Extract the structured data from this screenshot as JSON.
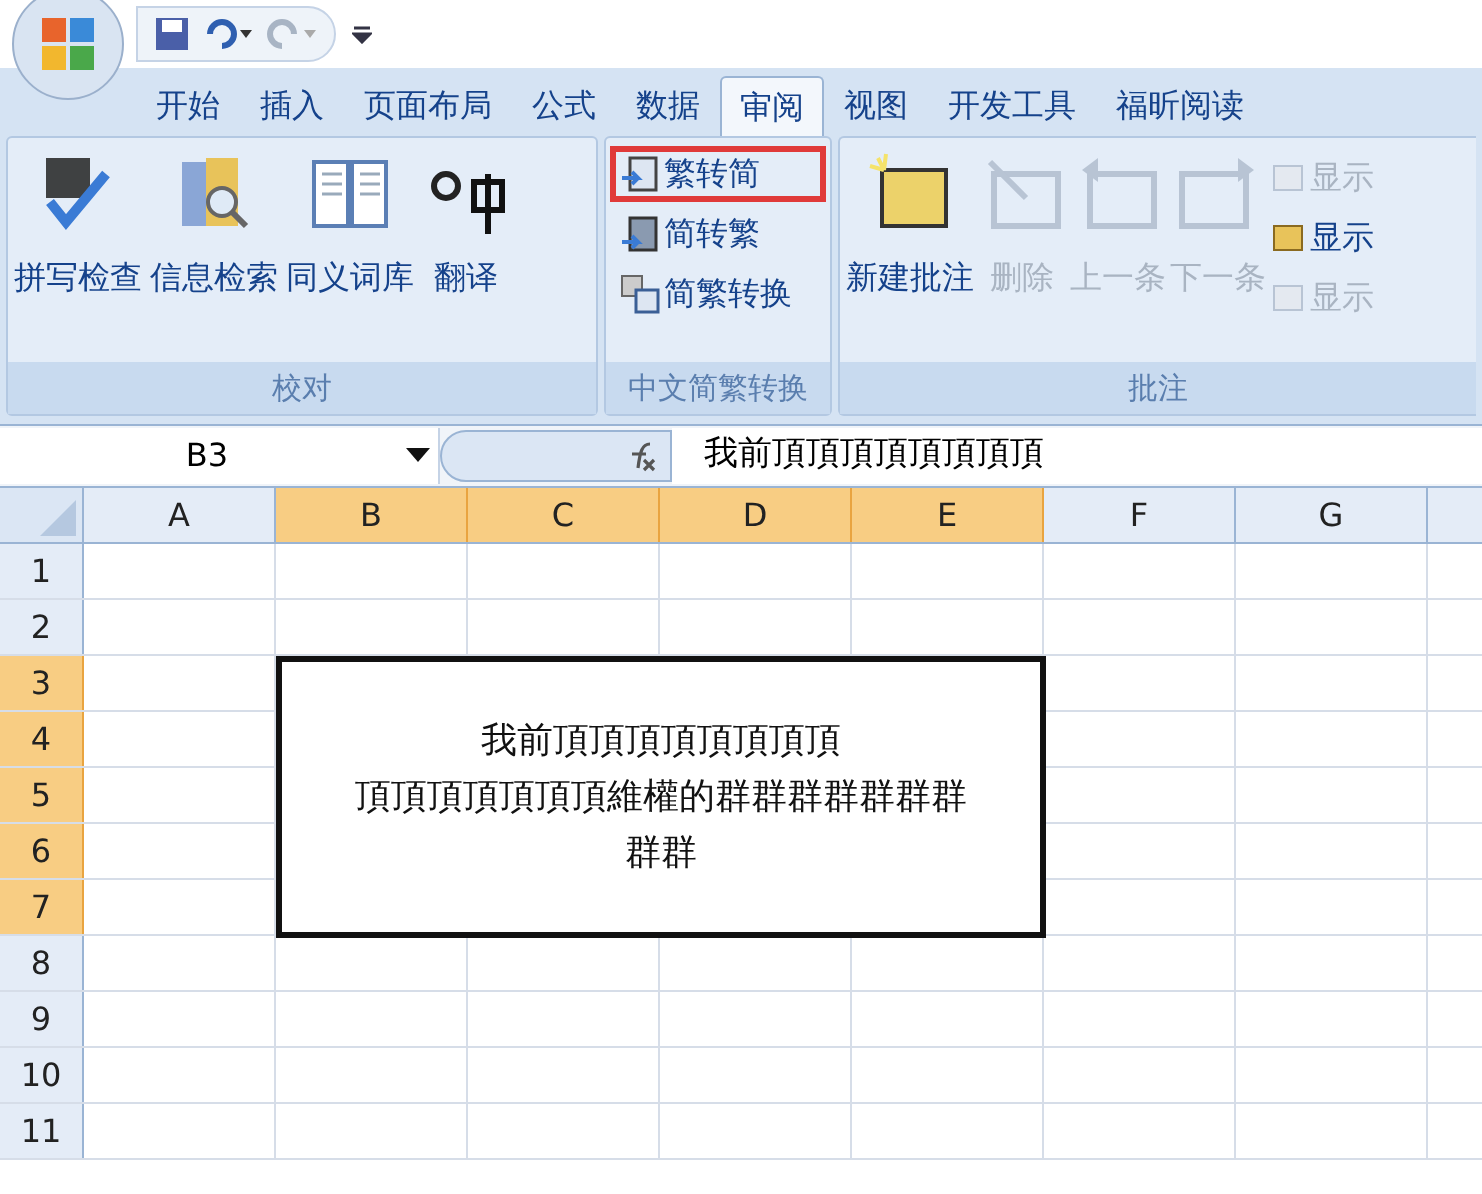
{
  "tabs": [
    {
      "label": "开始",
      "selected": false
    },
    {
      "label": "插入",
      "selected": false
    },
    {
      "label": "页面布局",
      "selected": false
    },
    {
      "label": "公式",
      "selected": false
    },
    {
      "label": "数据",
      "selected": false
    },
    {
      "label": "审阅",
      "selected": true
    },
    {
      "label": "视图",
      "selected": false
    },
    {
      "label": "开发工具",
      "selected": false
    },
    {
      "label": "福昕阅读",
      "selected": false
    }
  ],
  "ribbon": {
    "proofing": {
      "title": "校对",
      "buttons": [
        {
          "label": "拼写检查",
          "kind": "spell"
        },
        {
          "label": "信息检索",
          "kind": "research"
        },
        {
          "label": "同义词库",
          "kind": "thesaurus"
        },
        {
          "label": "翻译",
          "kind": "translate"
        }
      ]
    },
    "chinese": {
      "title": "中文简繁转换",
      "buttons": [
        {
          "label": "繁转简",
          "kind": "t2s",
          "annotated": true
        },
        {
          "label": "简转繁",
          "kind": "s2t",
          "annotated": false
        },
        {
          "label": "简繁转换",
          "kind": "convert",
          "annotated": false
        }
      ]
    },
    "comments": {
      "title": "批注",
      "buttons": [
        {
          "label": "新建批注",
          "kind": "new",
          "disabled": false
        },
        {
          "label": "删除",
          "kind": "delete",
          "disabled": true
        },
        {
          "label": "上一条",
          "kind": "prev",
          "disabled": true
        },
        {
          "label": "下一条",
          "kind": "next",
          "disabled": true
        }
      ],
      "small": [
        {
          "label": "显示",
          "disabled": true
        },
        {
          "label": "显示",
          "disabled": false
        },
        {
          "label": "显示",
          "disabled": true
        }
      ]
    }
  },
  "formula_bar": {
    "name_box": "B3",
    "formula": "我前頂頂頂頂頂頂頂頂"
  },
  "columns": [
    {
      "label": "A",
      "selected": false
    },
    {
      "label": "B",
      "selected": true
    },
    {
      "label": "C",
      "selected": true
    },
    {
      "label": "D",
      "selected": true
    },
    {
      "label": "E",
      "selected": true
    },
    {
      "label": "F",
      "selected": false
    },
    {
      "label": "G",
      "selected": false
    }
  ],
  "rows": [
    {
      "label": "1",
      "selected": false
    },
    {
      "label": "2",
      "selected": false
    },
    {
      "label": "3",
      "selected": true
    },
    {
      "label": "4",
      "selected": true
    },
    {
      "label": "5",
      "selected": true
    },
    {
      "label": "6",
      "selected": true
    },
    {
      "label": "7",
      "selected": true
    },
    {
      "label": "8",
      "selected": false
    },
    {
      "label": "9",
      "selected": false
    },
    {
      "label": "10",
      "selected": false
    },
    {
      "label": "11",
      "selected": false
    }
  ],
  "merged_cell": {
    "lines": [
      "我前頂頂頂頂頂頂頂頂",
      "頂頂頂頂頂頂頂維權的群群群群群群群",
      "群群"
    ]
  }
}
